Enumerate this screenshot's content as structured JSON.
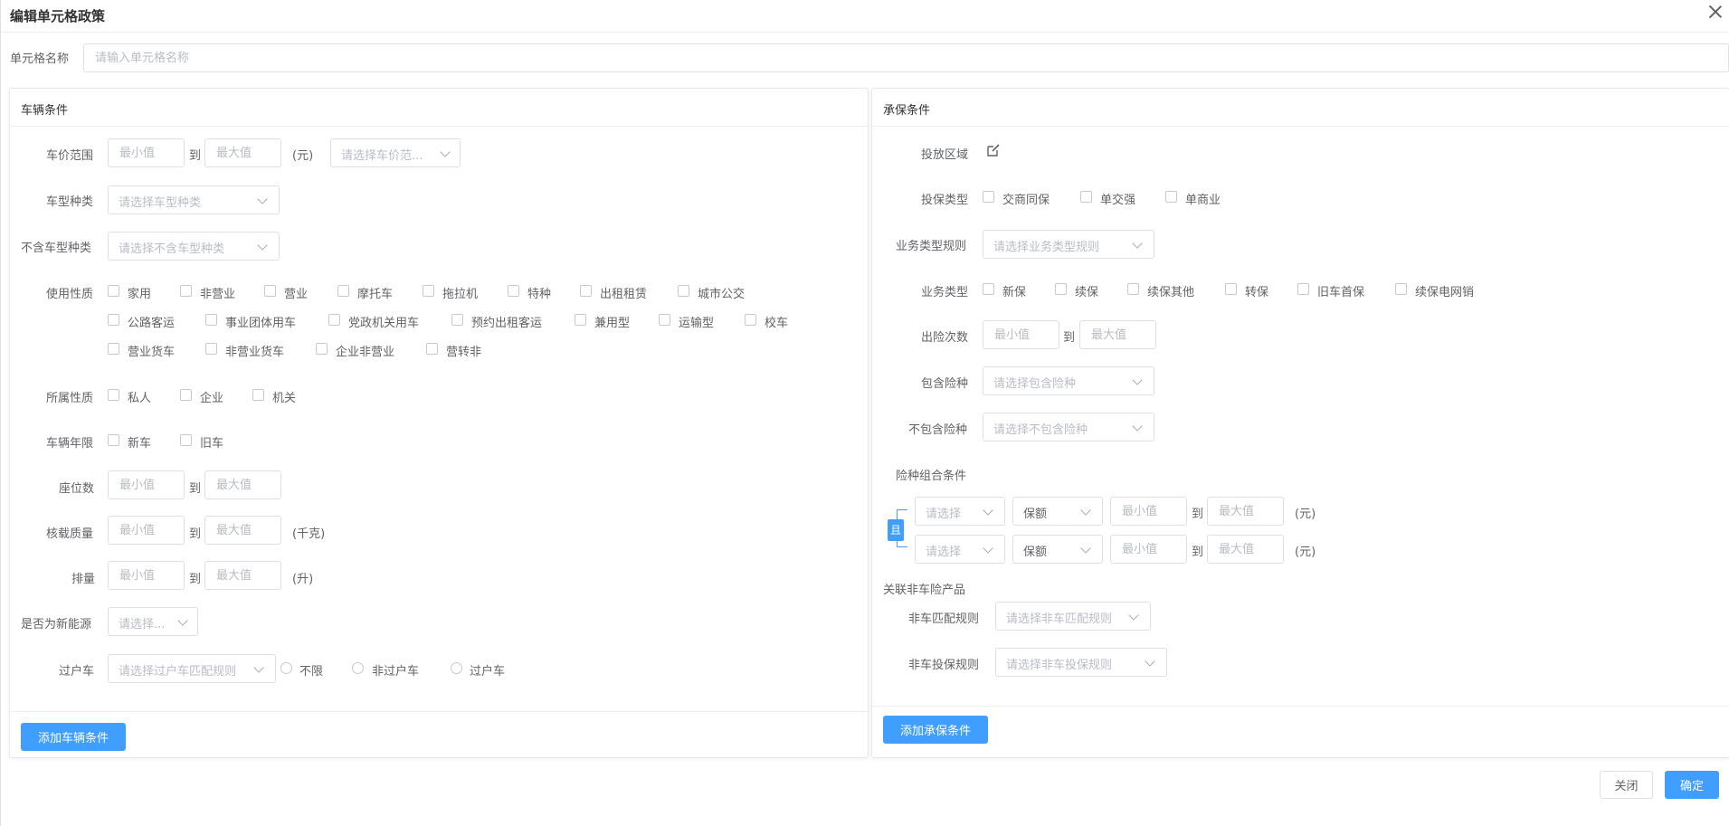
{
  "dialog": {
    "title": "编辑单元格政策",
    "cell_name_label": "单元格名称",
    "cell_name_placeholder": "请输入单元格名称",
    "close_label": "关闭",
    "confirm_label": "确定"
  },
  "vehicle": {
    "title": "车辆条件",
    "price_label": "车价范围",
    "min_placeholder": "最小值",
    "max_placeholder": "最大值",
    "to": "到",
    "yuan_unit": "(元)",
    "price_select": "请选择车价范...",
    "model_label": "车型种类",
    "model_select": "请选择车型种类",
    "exclude_model_label": "不含车型种类",
    "exclude_model_select": "请选择不含车型种类",
    "usage_label": "使用性质",
    "usage_options": [
      "家用",
      "非营业",
      "营业",
      "摩托车",
      "拖拉机",
      "特种",
      "出租租赁",
      "城市公交",
      "公路客运",
      "事业团体用车",
      "党政机关用车",
      "预约出租客运",
      "兼用型",
      "运输型",
      "校车",
      "营业货车",
      "非营业货车",
      "企业非营业",
      "营转非"
    ],
    "owner_label": "所属性质",
    "owner_options": [
      "私人",
      "企业",
      "机关"
    ],
    "age_label": "车辆年限",
    "age_options": [
      "新车",
      "旧车"
    ],
    "seats_label": "座位数",
    "load_label": "核载质量",
    "kg_unit": "(千克)",
    "displacement_label": "排量",
    "liter_unit": "(升)",
    "new_energy_label": "是否为新能源",
    "new_energy_select": "请选择...",
    "transfer_label": "过户车",
    "transfer_select": "请选择过户车匹配规则",
    "transfer_options": [
      "不限",
      "非过户车",
      "过户车"
    ],
    "add_button": "添加车辆条件"
  },
  "underwriting": {
    "title": "承保条件",
    "region_label": "投放区域",
    "insure_type_label": "投保类型",
    "insure_type_options": [
      "交商同保",
      "单交强",
      "单商业"
    ],
    "biz_rule_label": "业务类型规则",
    "biz_rule_select": "请选择业务类型规则",
    "biz_type_label": "业务类型",
    "biz_type_options": [
      "新保",
      "续保",
      "续保其他",
      "转保",
      "旧车首保",
      "续保电网销"
    ],
    "claims_label": "出险次数",
    "min_placeholder": "最小值",
    "max_placeholder": "最大值",
    "to": "到",
    "include_label": "包含险种",
    "include_select": "请选择包含险种",
    "exclude_label": "不包含险种",
    "exclude_select": "请选择不包含险种",
    "combo_label": "险种组合条件",
    "combo_and": "且",
    "combo_rows": [
      {
        "select": "请选择",
        "amount": "保额",
        "unit": "(元)"
      },
      {
        "select": "请选择",
        "amount": "保额",
        "unit": "(元)"
      }
    ],
    "nonauto_title": "关联非车险产品",
    "nonauto_match_label": "非车匹配规则",
    "nonauto_match_select": "请选择非车匹配规则",
    "nonauto_insure_label": "非车投保规则",
    "nonauto_insure_select": "请选择非车投保规则",
    "add_button": "添加承保条件"
  },
  "icons": {
    "close": "close-icon",
    "edit": "edit-icon",
    "chevron": "chevron-down-icon"
  },
  "colors": {
    "primary": "#409eff",
    "border": "#dcdfe6",
    "text": "#606266",
    "placeholder": "#b8bcc4"
  }
}
